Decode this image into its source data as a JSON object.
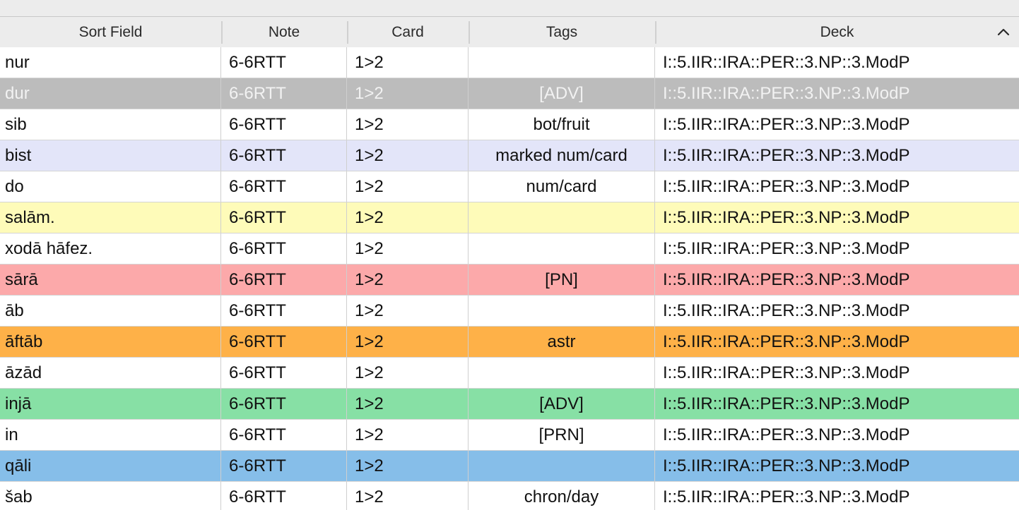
{
  "columns": {
    "sort_field": "Sort Field",
    "note": "Note",
    "card": "Card",
    "tags": "Tags",
    "deck": "Deck"
  },
  "sort": {
    "column": "deck",
    "direction": "ascending",
    "icon": "chevron-up-icon"
  },
  "row_colors": {
    "plain": "#ffffff",
    "selected": "#bcbcbc",
    "marked": "#e3e5f9",
    "yellow": "#fefbb9",
    "red": "#fca9aa",
    "orange": "#feb148",
    "green": "#87e0a5",
    "blue": "#86bee9"
  },
  "rows": [
    {
      "sort_field": "nur",
      "note": "6-6RTT",
      "card": "1>2",
      "tags": "",
      "deck": "I::5.IIR::IRA::PER::3.NP::3.ModP",
      "color": "plain"
    },
    {
      "sort_field": "dur",
      "note": "6-6RTT",
      "card": "1>2",
      "tags": "[ADV]",
      "deck": "I::5.IIR::IRA::PER::3.NP::3.ModP",
      "color": "selected"
    },
    {
      "sort_field": "sib",
      "note": "6-6RTT",
      "card": "1>2",
      "tags": "bot/fruit",
      "deck": "I::5.IIR::IRA::PER::3.NP::3.ModP",
      "color": "plain"
    },
    {
      "sort_field": "bist",
      "note": "6-6RTT",
      "card": "1>2",
      "tags": "marked num/card",
      "deck": "I::5.IIR::IRA::PER::3.NP::3.ModP",
      "color": "marked"
    },
    {
      "sort_field": "do",
      "note": "6-6RTT",
      "card": "1>2",
      "tags": "num/card",
      "deck": "I::5.IIR::IRA::PER::3.NP::3.ModP",
      "color": "plain"
    },
    {
      "sort_field": "salām.",
      "note": "6-6RTT",
      "card": "1>2",
      "tags": "",
      "deck": "I::5.IIR::IRA::PER::3.NP::3.ModP",
      "color": "yellow"
    },
    {
      "sort_field": "xodā hāfez.",
      "note": "6-6RTT",
      "card": "1>2",
      "tags": "",
      "deck": "I::5.IIR::IRA::PER::3.NP::3.ModP",
      "color": "plain"
    },
    {
      "sort_field": "sārā",
      "note": "6-6RTT",
      "card": "1>2",
      "tags": "[PN]",
      "deck": "I::5.IIR::IRA::PER::3.NP::3.ModP",
      "color": "red"
    },
    {
      "sort_field": "āb",
      "note": "6-6RTT",
      "card": "1>2",
      "tags": "",
      "deck": "I::5.IIR::IRA::PER::3.NP::3.ModP",
      "color": "plain"
    },
    {
      "sort_field": "āftāb",
      "note": "6-6RTT",
      "card": "1>2",
      "tags": "astr",
      "deck": "I::5.IIR::IRA::PER::3.NP::3.ModP",
      "color": "orange"
    },
    {
      "sort_field": "āzād",
      "note": "6-6RTT",
      "card": "1>2",
      "tags": "",
      "deck": "I::5.IIR::IRA::PER::3.NP::3.ModP",
      "color": "plain"
    },
    {
      "sort_field": "injā",
      "note": "6-6RTT",
      "card": "1>2",
      "tags": "[ADV]",
      "deck": "I::5.IIR::IRA::PER::3.NP::3.ModP",
      "color": "green"
    },
    {
      "sort_field": "in",
      "note": "6-6RTT",
      "card": "1>2",
      "tags": "[PRN]",
      "deck": "I::5.IIR::IRA::PER::3.NP::3.ModP",
      "color": "plain"
    },
    {
      "sort_field": "qāli",
      "note": "6-6RTT",
      "card": "1>2",
      "tags": "",
      "deck": "I::5.IIR::IRA::PER::3.NP::3.ModP",
      "color": "blue"
    },
    {
      "sort_field": "šab",
      "note": "6-6RTT",
      "card": "1>2",
      "tags": "chron/day",
      "deck": "I::5.IIR::IRA::PER::3.NP::3.ModP",
      "color": "plain"
    }
  ]
}
